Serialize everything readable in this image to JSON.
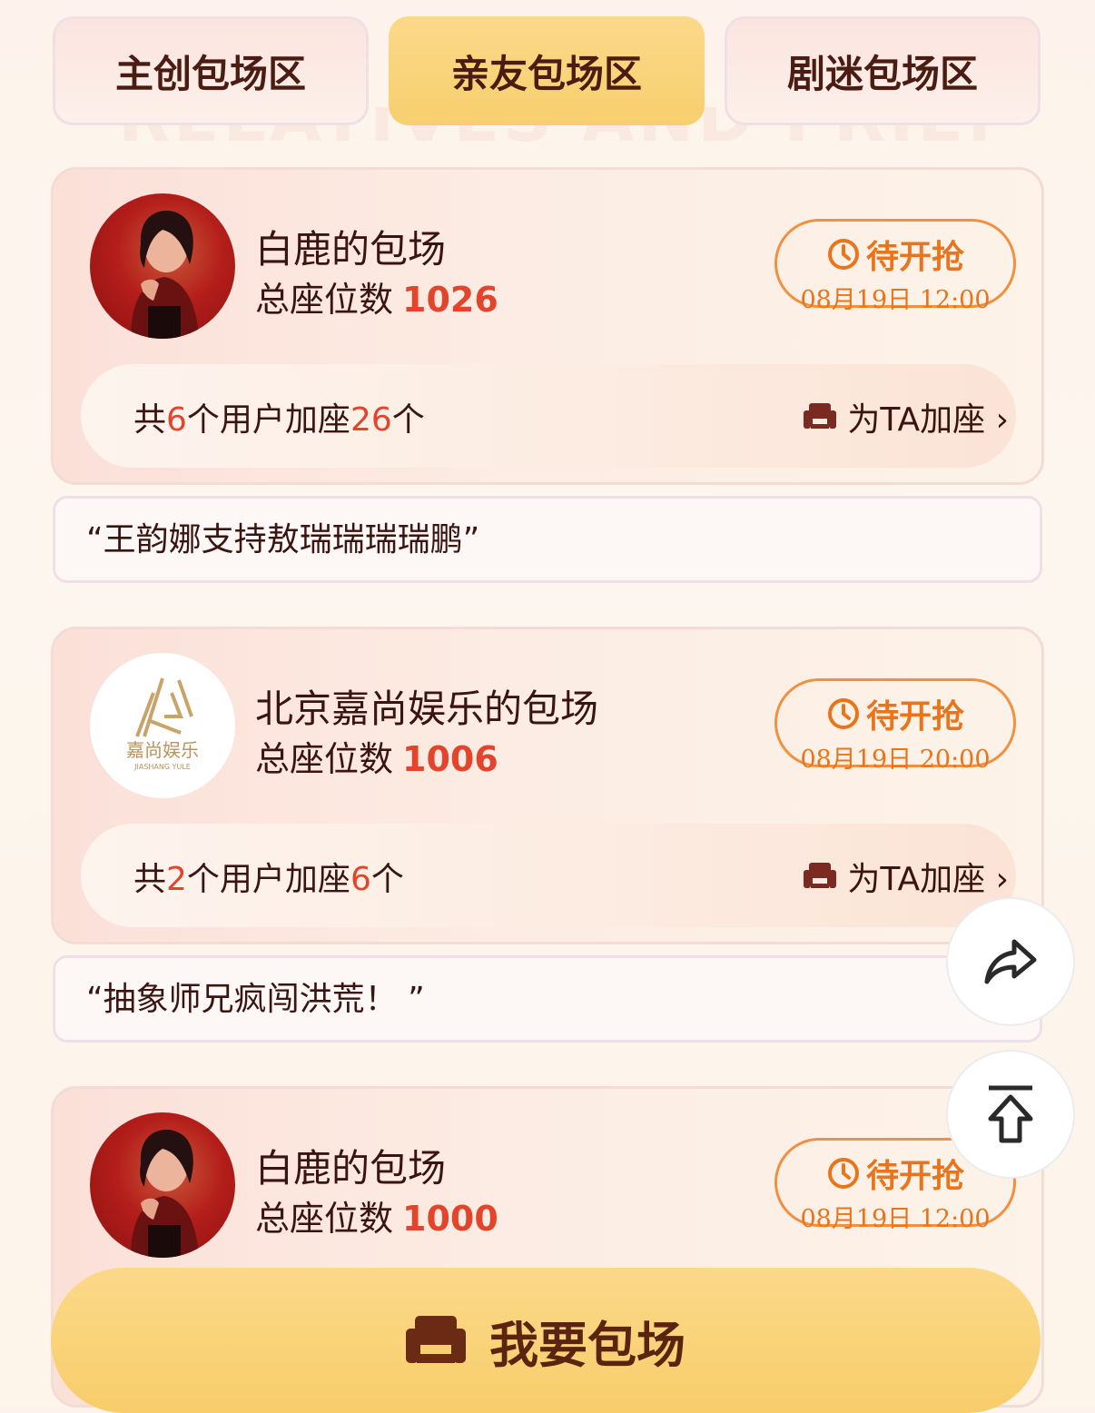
{
  "tabs": [
    {
      "label": "主创包场区",
      "active": false
    },
    {
      "label": "亲友包场区",
      "active": true
    },
    {
      "label": "剧迷包场区",
      "active": false
    }
  ],
  "watermark": "RELATIVES AND FRIENDS",
  "cards": [
    {
      "title": "白鹿的包场",
      "seats_label": "总座位数",
      "seats_count": "1026",
      "status": "待开抢",
      "time": "08月19日 12:00",
      "join_prefix": "共",
      "join_users": "6",
      "join_mid": "个用户加座",
      "join_seats": "26",
      "join_suffix": "个",
      "add_label": "为TA加座 ›",
      "quote": "“王韵娜支持敖瑞瑞瑞瑞鹏”"
    },
    {
      "title": "北京嘉尚娱乐的包场",
      "seats_label": "总座位数",
      "seats_count": "1006",
      "status": "待开抢",
      "time": "08月19日 20:00",
      "join_prefix": "共",
      "join_users": "2",
      "join_mid": "个用户加座",
      "join_seats": "6",
      "join_suffix": "个",
      "add_label": "为TA加座 ›",
      "quote": "“抽象师兄疯闯洪荒！ ”",
      "logo_text": "嘉尚娱乐",
      "logo_sub": "JIASHANG YULE"
    },
    {
      "title": "白鹿的包场",
      "seats_label": "总座位数",
      "seats_count": "1000",
      "status": "待开抢",
      "time": "08月19日 12:00"
    }
  ],
  "cta": {
    "label": "我要包场"
  },
  "icons": {
    "share": "share-icon",
    "top": "back-to-top-icon",
    "clock": "clock-icon",
    "sofa": "sofa-icon"
  },
  "colors": {
    "accent": "#e8741c",
    "highlight": "#e2452c",
    "primary": "#f8cf6e"
  }
}
